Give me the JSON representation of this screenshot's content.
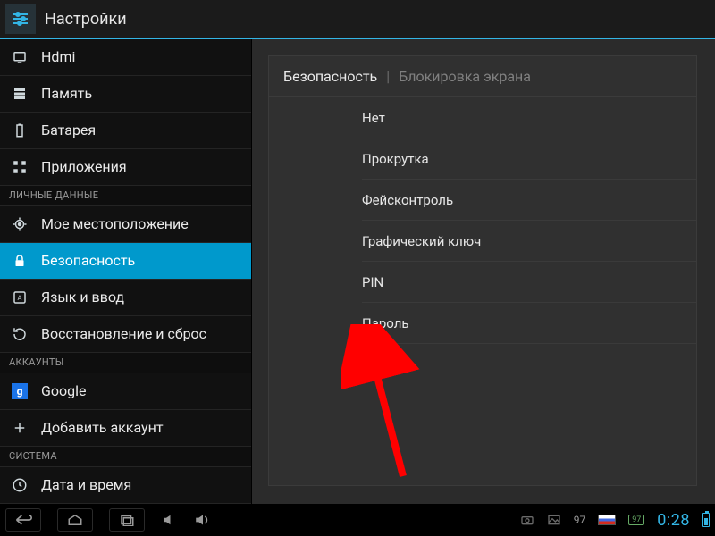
{
  "header": {
    "title": "Настройки"
  },
  "sidebar": {
    "items": [
      {
        "label": "Hdmi",
        "icon": "hdmi"
      },
      {
        "label": "Память",
        "icon": "storage"
      },
      {
        "label": "Батарея",
        "icon": "battery"
      },
      {
        "label": "Приложения",
        "icon": "apps"
      }
    ],
    "section_personal": "ЛИЧНЫЕ ДАННЫЕ",
    "personal": [
      {
        "label": "Мое местоположение",
        "icon": "location"
      },
      {
        "label": "Безопасность",
        "icon": "lock",
        "selected": true
      },
      {
        "label": "Язык и ввод",
        "icon": "language"
      },
      {
        "label": "Восстановление и сброс",
        "icon": "backup"
      }
    ],
    "section_accounts": "АККАУНТЫ",
    "accounts": [
      {
        "label": "Google",
        "icon": "google"
      },
      {
        "label": "Добавить аккаунт",
        "icon": "plus"
      }
    ],
    "section_system": "СИСТЕМА",
    "system": [
      {
        "label": "Дата и время",
        "icon": "clock"
      }
    ]
  },
  "main": {
    "breadcrumb": {
      "section": "Безопасность",
      "page": "Блокировка экрана"
    },
    "options": [
      {
        "label": "Нет"
      },
      {
        "label": "Прокрутка"
      },
      {
        "label": "Фейсконтроль"
      },
      {
        "label": "Графический ключ"
      },
      {
        "label": "PIN"
      },
      {
        "label": "Пароль"
      }
    ]
  },
  "navbar": {
    "battery_pct": "97",
    "clock": "0:28"
  },
  "annotation": {
    "arrow_color": "#ff0000"
  }
}
